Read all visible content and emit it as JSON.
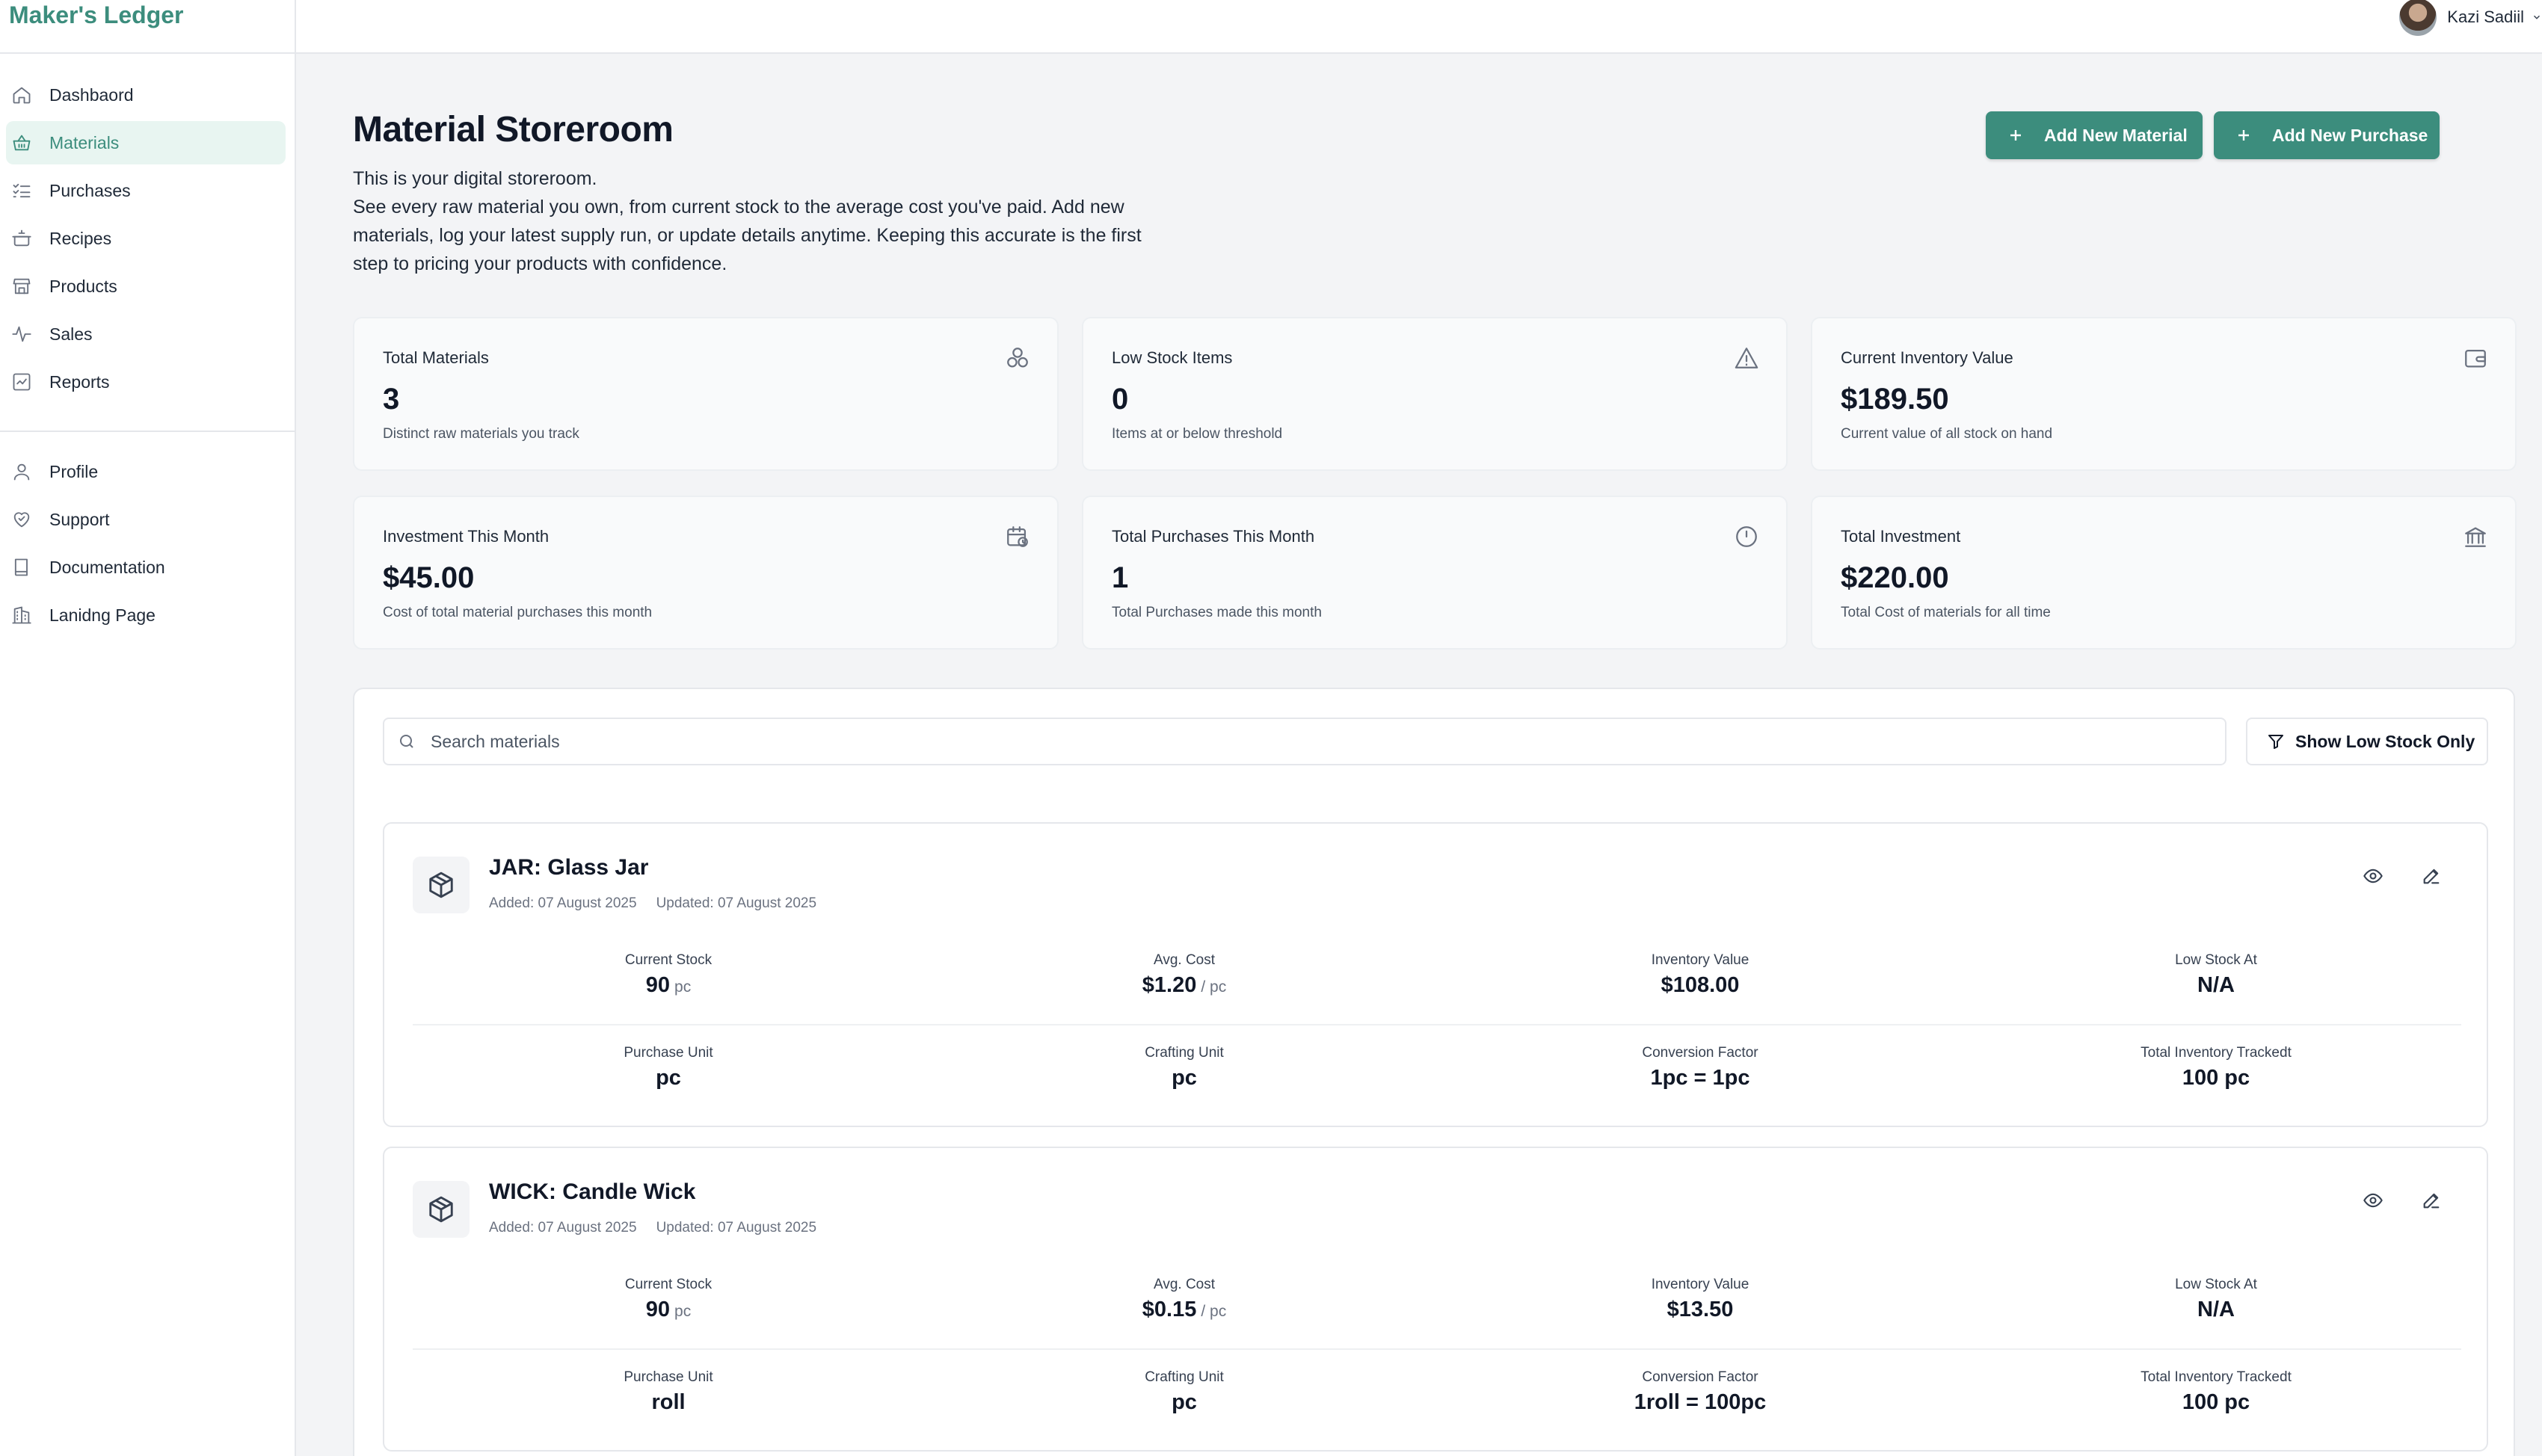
{
  "app": {
    "brand": "Maker's Ledger",
    "accent_color": "#3c8d7d"
  },
  "sidebar": {
    "primary": [
      {
        "label": "Dashbaord",
        "icon": "home-icon",
        "active": false
      },
      {
        "label": "Materials",
        "icon": "basket-icon",
        "active": true
      },
      {
        "label": "Purchases",
        "icon": "list-check-icon",
        "active": false
      },
      {
        "label": "Recipes",
        "icon": "pot-icon",
        "active": false
      },
      {
        "label": "Products",
        "icon": "store-icon",
        "active": false
      },
      {
        "label": "Sales",
        "icon": "activity-icon",
        "active": false
      },
      {
        "label": "Reports",
        "icon": "chart-square-icon",
        "active": false
      }
    ],
    "secondary": [
      {
        "label": "Profile",
        "icon": "user-icon"
      },
      {
        "label": "Support",
        "icon": "heart-handshake-icon"
      },
      {
        "label": "Documentation",
        "icon": "book-icon"
      },
      {
        "label": "Lanidng Page",
        "icon": "building-icon"
      }
    ]
  },
  "topbar": {
    "user_name": "Kazi Sadiil"
  },
  "header": {
    "title": "Material Storeroom",
    "desc_line1": "This is your digital storeroom.",
    "desc_line2": "See every raw material you own, from current stock to the average cost you've paid. Add new materials, log your latest supply run, or update details anytime. Keeping this accurate is the first step to pricing your products with confidence.",
    "add_material_label": "Add New Material",
    "add_purchase_label": "Add New Purchase"
  },
  "stats": [
    {
      "label": "Total Materials",
      "value": "3",
      "sub": "Distinct raw materials you track",
      "icon": "boxes-icon"
    },
    {
      "label": "Low Stock Items",
      "value": "0",
      "sub": "Items at or below threshold",
      "icon": "warning-icon"
    },
    {
      "label": "Current Inventory Value",
      "value": "$189.50",
      "sub": "Current value of all stock on hand",
      "icon": "wallet-icon"
    },
    {
      "label": "Investment This Month",
      "value": "$45.00",
      "sub": "Cost of total material purchases this month",
      "icon": "calendar-clock-icon"
    },
    {
      "label": "Total Purchases This Month",
      "value": "1",
      "sub": "Total Purchases made this month",
      "icon": "clock-icon"
    },
    {
      "label": "Total Investment",
      "value": "$220.00",
      "sub": "Total Cost of materials for all time",
      "icon": "bank-icon"
    }
  ],
  "search": {
    "placeholder": "Search materials",
    "value": ""
  },
  "filter": {
    "label": "Show Low Stock Only"
  },
  "metric_labels": {
    "current_stock": "Current Stock",
    "avg_cost": "Avg. Cost",
    "inventory_value": "Inventory Value",
    "low_stock_at": "Low Stock At",
    "purchase_unit": "Purchase Unit",
    "crafting_unit": "Crafting Unit",
    "conversion_factor": "Conversion Factor",
    "total_tracked": "Total Inventory Trackedt"
  },
  "materials": [
    {
      "title": "JAR: Glass Jar",
      "added": "Added: 07 August 2025",
      "updated": "Updated: 07 August 2025",
      "current_stock": "90",
      "current_stock_unit": "pc",
      "avg_cost": "$1.20",
      "avg_cost_unit": "/ pc",
      "inventory_value": "$108.00",
      "low_stock_at": "N/A",
      "purchase_unit": "pc",
      "crafting_unit": "pc",
      "conversion_factor": "1pc = 1pc",
      "total_tracked": "100 pc"
    },
    {
      "title": "WICK: Candle Wick",
      "added": "Added: 07 August 2025",
      "updated": "Updated: 07 August 2025",
      "current_stock": "90",
      "current_stock_unit": "pc",
      "avg_cost": "$0.15",
      "avg_cost_unit": "/ pc",
      "inventory_value": "$13.50",
      "low_stock_at": "N/A",
      "purchase_unit": "roll",
      "crafting_unit": "pc",
      "conversion_factor": "1roll = 100pc",
      "total_tracked": "100 pc"
    }
  ]
}
